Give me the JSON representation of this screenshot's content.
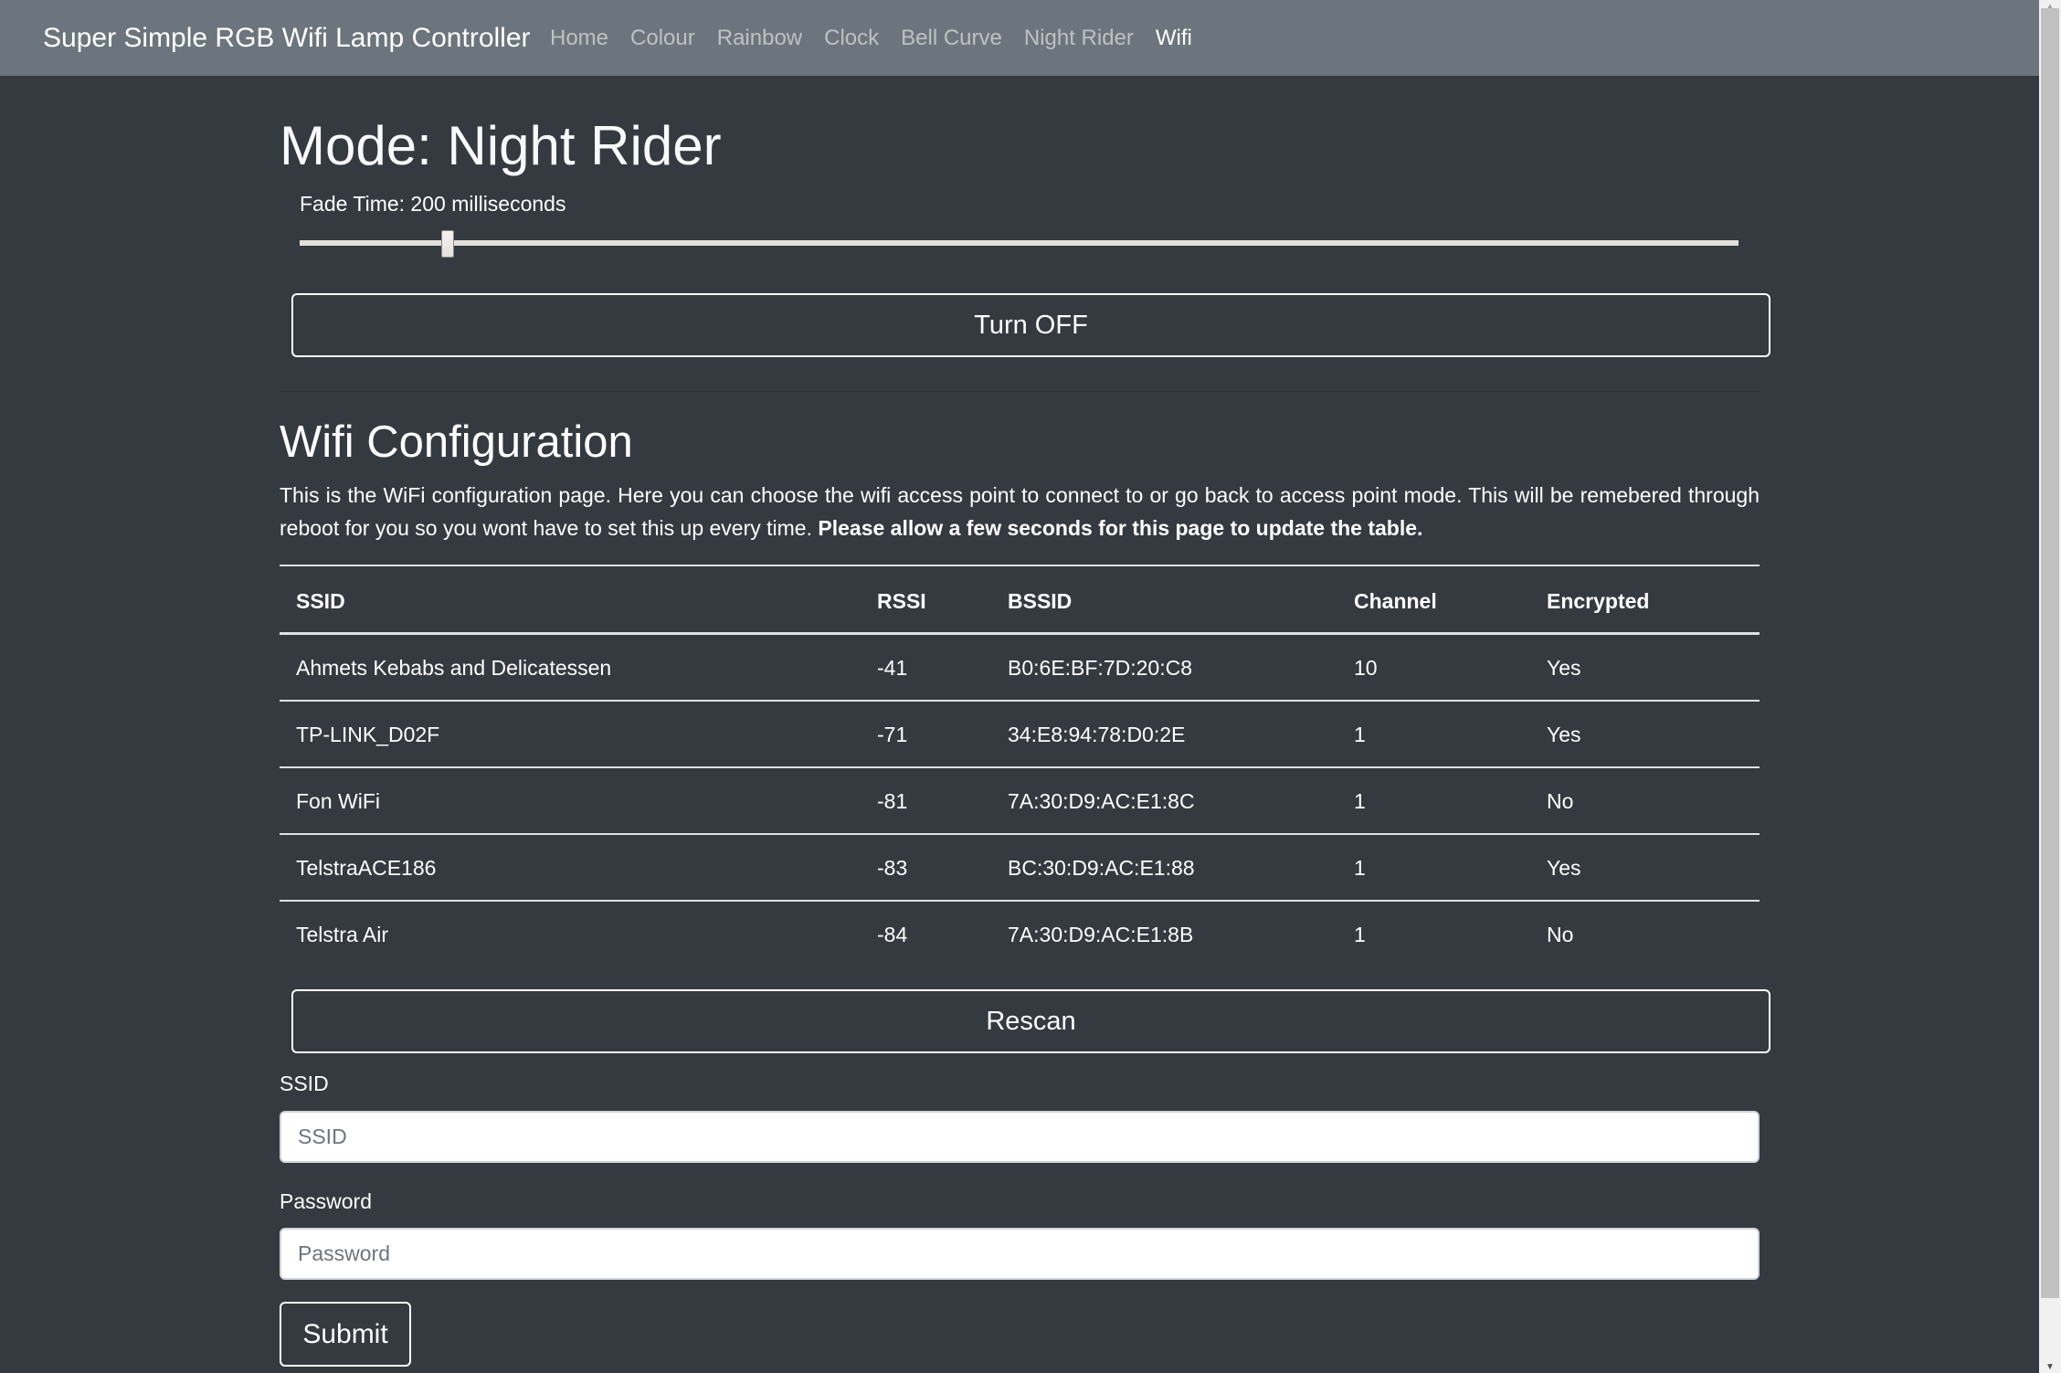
{
  "navbar": {
    "brand": "Super Simple RGB Wifi Lamp Controller",
    "links": [
      {
        "label": "Home",
        "active": false
      },
      {
        "label": "Colour",
        "active": false
      },
      {
        "label": "Rainbow",
        "active": false
      },
      {
        "label": "Clock",
        "active": false
      },
      {
        "label": "Bell Curve",
        "active": false
      },
      {
        "label": "Night Rider",
        "active": false
      },
      {
        "label": "Wifi",
        "active": true
      }
    ]
  },
  "mode": {
    "title": "Mode: Night Rider",
    "fade_label": "Fade Time: 200 milliseconds",
    "fade_slider_fraction": 0.103,
    "turn_off_label": "Turn OFF"
  },
  "wifi": {
    "heading": "Wifi Configuration",
    "intro_text": "This is the WiFi configuration page. Here you can choose the wifi access point to connect to or go back to access point mode. This will be remebered through reboot for you so you wont have to set this up every time. ",
    "intro_bold": "Please allow a few seconds for this page to update the table.",
    "table": {
      "headers": [
        "SSID",
        "RSSI",
        "BSSID",
        "Channel",
        "Encrypted"
      ],
      "rows": [
        {
          "ssid": "Ahmets Kebabs and Delicatessen",
          "rssi": "-41",
          "bssid": "B0:6E:BF:7D:20:C8",
          "channel": "10",
          "encrypted": "Yes"
        },
        {
          "ssid": "TP-LINK_D02F",
          "rssi": "-71",
          "bssid": "34:E8:94:78:D0:2E",
          "channel": "1",
          "encrypted": "Yes"
        },
        {
          "ssid": "Fon WiFi",
          "rssi": "-81",
          "bssid": "7A:30:D9:AC:E1:8C",
          "channel": "1",
          "encrypted": "No"
        },
        {
          "ssid": "TelstraACE186",
          "rssi": "-83",
          "bssid": "BC:30:D9:AC:E1:88",
          "channel": "1",
          "encrypted": "Yes"
        },
        {
          "ssid": "Telstra Air",
          "rssi": "-84",
          "bssid": "7A:30:D9:AC:E1:8B",
          "channel": "1",
          "encrypted": "No"
        }
      ]
    },
    "rescan_label": "Rescan",
    "form": {
      "ssid_label": "SSID",
      "ssid_value": "",
      "ssid_placeholder": "SSID",
      "password_label": "Password",
      "password_value": "",
      "password_placeholder": "Password",
      "submit_label": "Submit"
    }
  },
  "colors": {
    "navbar_bg": "#6c757d",
    "page_bg": "#343a40",
    "text": "#ffffff",
    "nav_inactive": "rgba(255,255,255,0.55)"
  },
  "scrollbar": {
    "up_icon": "▲",
    "down_icon": "▼"
  }
}
